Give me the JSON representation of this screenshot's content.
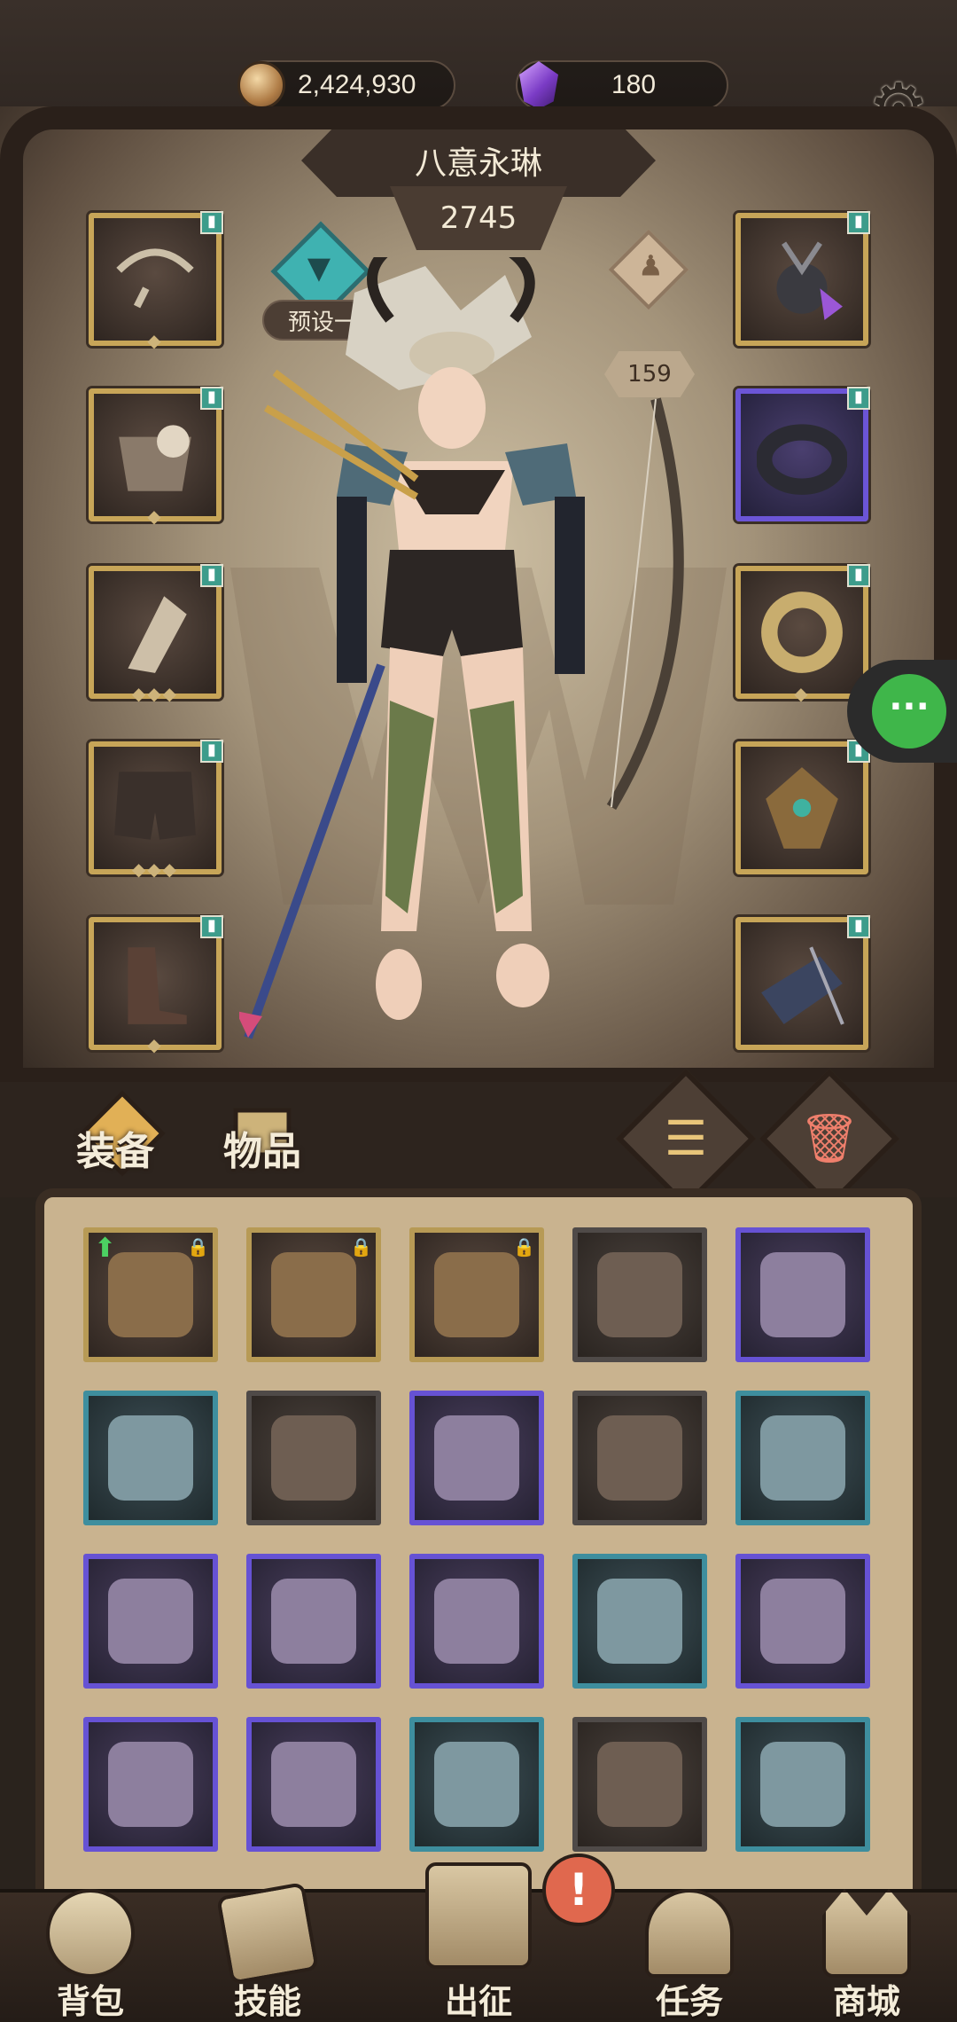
{
  "currency": {
    "gold": "2,424,930",
    "gems": "180"
  },
  "hero": {
    "name": "八意永琳",
    "power": "2745",
    "preset_label": "预设一",
    "level": "159"
  },
  "tabs": {
    "equipment": "装备",
    "items": "物品"
  },
  "nav": {
    "bag": "背包",
    "skills": "技能",
    "expedition": "出征",
    "quests": "任务",
    "shop": "商城"
  },
  "equipped_left": [
    {
      "slot": "weapon",
      "icon": "bow-icon",
      "rarity": "gold"
    },
    {
      "slot": "armor",
      "icon": "chest-armor-icon",
      "rarity": "gold"
    },
    {
      "slot": "gloves",
      "icon": "bracer-icon",
      "rarity": "gold"
    },
    {
      "slot": "pants",
      "icon": "shorts-icon",
      "rarity": "gold"
    },
    {
      "slot": "boots",
      "icon": "boots-icon",
      "rarity": "gold"
    }
  ],
  "equipped_right": [
    {
      "slot": "necklace",
      "icon": "chain-amulet-icon",
      "rarity": "gold"
    },
    {
      "slot": "ring",
      "icon": "ring-icon",
      "rarity": "purple"
    },
    {
      "slot": "ring2",
      "icon": "gold-ring-icon",
      "rarity": "gold"
    },
    {
      "slot": "trinket",
      "icon": "emblem-icon",
      "rarity": "gold"
    },
    {
      "slot": "quiver",
      "icon": "quiver-icon",
      "rarity": "gold"
    }
  ],
  "inventory": [
    {
      "icon": "bow-icon",
      "rarity": "gold",
      "locked": true,
      "upgrade": true
    },
    {
      "icon": "longbow-icon",
      "rarity": "gold",
      "locked": true,
      "upgrade": false
    },
    {
      "icon": "leather-pants-icon",
      "rarity": "gold",
      "locked": true,
      "upgrade": false
    },
    {
      "icon": "gauntlet-icon",
      "rarity": "dark",
      "locked": false,
      "upgrade": false
    },
    {
      "icon": "tunic-icon",
      "rarity": "purple",
      "locked": false,
      "upgrade": false
    },
    {
      "icon": "horn-helm-icon",
      "rarity": "blue",
      "locked": false,
      "upgrade": false
    },
    {
      "icon": "hood-icon",
      "rarity": "dark",
      "locked": false,
      "upgrade": false
    },
    {
      "icon": "cloth-pants-icon",
      "rarity": "purple",
      "locked": false,
      "upgrade": false
    },
    {
      "icon": "horn-helm-icon",
      "rarity": "dark",
      "locked": false,
      "upgrade": false
    },
    {
      "icon": "iron-helm-icon",
      "rarity": "blue",
      "locked": false,
      "upgrade": false
    },
    {
      "icon": "boots-icon",
      "rarity": "purple",
      "locked": false,
      "upgrade": false
    },
    {
      "icon": "hat-icon",
      "rarity": "purple",
      "locked": false,
      "upgrade": false
    },
    {
      "icon": "chain-ring-icon",
      "rarity": "purple",
      "locked": false,
      "upgrade": false
    },
    {
      "icon": "fur-boots-icon",
      "rarity": "blue",
      "locked": false,
      "upgrade": false
    },
    {
      "icon": "vest-icon",
      "rarity": "purple",
      "locked": false,
      "upgrade": false
    },
    {
      "icon": "scarf-icon",
      "rarity": "purple",
      "locked": false,
      "upgrade": false
    },
    {
      "icon": "bracer-icon",
      "rarity": "purple",
      "locked": false,
      "upgrade": false
    },
    {
      "icon": "crossbow-icon",
      "rarity": "blue",
      "locked": false,
      "upgrade": false
    },
    {
      "icon": "dagger-icon",
      "rarity": "dark",
      "locked": false,
      "upgrade": false
    },
    {
      "icon": "shoulder-guard-icon",
      "rarity": "blue",
      "locked": false,
      "upgrade": false
    }
  ],
  "colors": {
    "gold_frame": "#b79a55",
    "purple_frame": "#6652d4",
    "blue_frame": "#3e8e9e",
    "chat_green": "#3fb64a",
    "alert_red": "#e0684e"
  }
}
